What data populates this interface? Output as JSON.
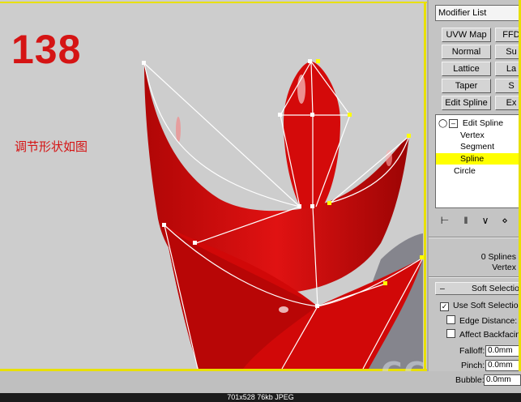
{
  "viewport": {
    "step_number": "138",
    "caption": "调节形状如图"
  },
  "panel": {
    "modifier_list": "Modifier List",
    "buttons": [
      {
        "label": "UVW Map"
      },
      {
        "label": "FFD"
      },
      {
        "label": "Normal"
      },
      {
        "label": "Su"
      },
      {
        "label": "Lattice"
      },
      {
        "label": "La"
      },
      {
        "label": "Taper"
      },
      {
        "label": "S"
      },
      {
        "label": "Edit Spline"
      },
      {
        "label": "Ex"
      }
    ],
    "stack": {
      "root": "Edit Spline",
      "vertex": "Vertex",
      "segment": "Segment",
      "spline": "Spline",
      "circle": "Circle"
    },
    "selection_info": {
      "line1": "0 Splines",
      "line2": "Vertex"
    },
    "soft_selection": {
      "header": "Soft Selection",
      "use_soft_selection": "Use Soft Selection",
      "edge_distance": "Edge Distance:",
      "affect_backfacing": "Affect Backfacing",
      "falloff_label": "Falloff:",
      "falloff_value": "0.0mm",
      "pinch_label": "Pinch:",
      "pinch_value": "0.0mm",
      "bubble_label": "Bubble:",
      "bubble_value": "0.0mm"
    }
  },
  "file_info": "701x528  76kb  JPEG",
  "watermark": "CC",
  "colors": {
    "accent_yellow": "#e8e000",
    "object_red": "#d40a0a",
    "annotation_red": "#d51414"
  }
}
